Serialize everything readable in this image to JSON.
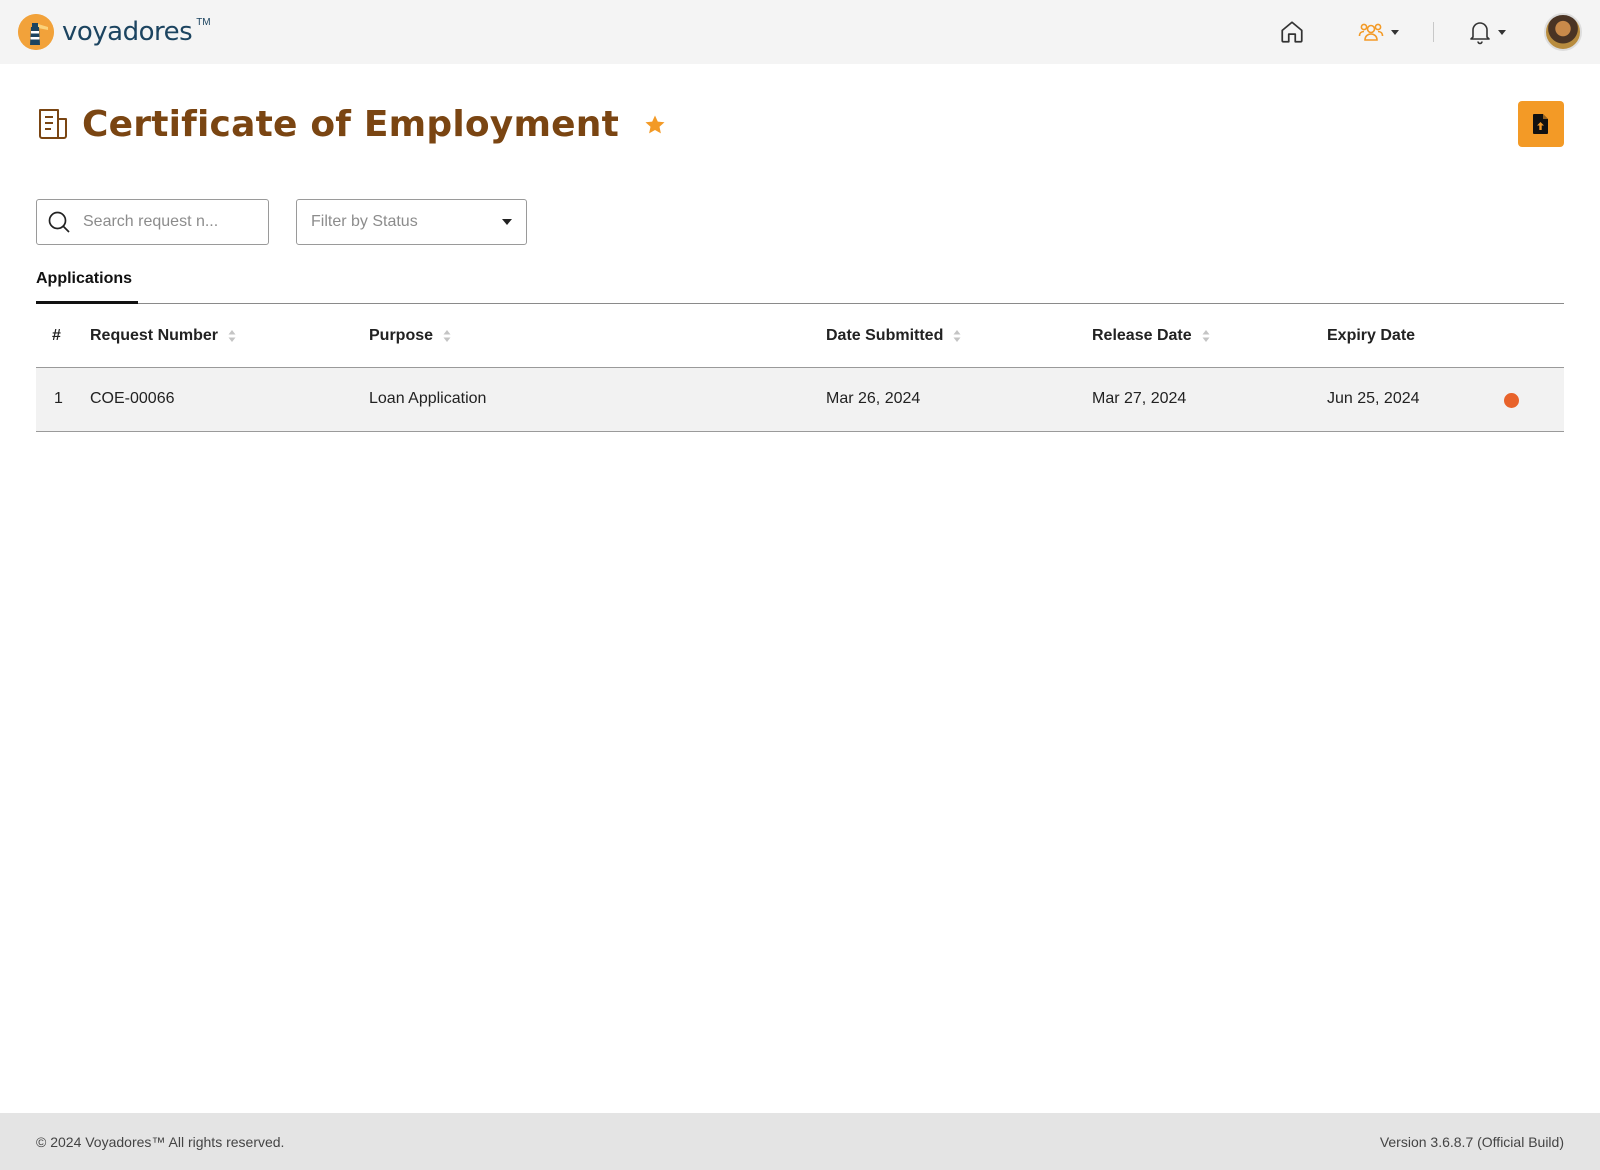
{
  "brand": {
    "name": "voyadores",
    "tm": "TM"
  },
  "nav": {
    "home_icon": "home-icon",
    "team_icon": "users-icon",
    "bell_icon": "bell-icon"
  },
  "page": {
    "title": "Certificate of Employment",
    "title_icon": "document-icon",
    "favorite_icon": "star-icon",
    "upload_icon": "file-upload-icon"
  },
  "filters": {
    "search_placeholder": "Search request n...",
    "status_placeholder": "Filter by Status"
  },
  "tabs": [
    {
      "label": "Applications",
      "active": true
    }
  ],
  "table": {
    "columns": [
      "#",
      "Request Number",
      "Purpose",
      "Date Submitted",
      "Release Date",
      "Expiry Date"
    ],
    "rows": [
      {
        "index": "1",
        "request_number": "COE-00066",
        "purpose": "Loan Application",
        "date_submitted": "Mar 26, 2024",
        "release_date": "Mar 27, 2024",
        "expiry_date": "Jun 25, 2024",
        "status_color": "#e8632b"
      }
    ]
  },
  "footer": {
    "copyright": "© 2024 Voyadores™ All rights reserved.",
    "version": "Version 3.6.8.7 (Official Build)"
  },
  "colors": {
    "accent": "#f39a26",
    "title": "#7a4512",
    "brand_text": "#1c4460"
  }
}
